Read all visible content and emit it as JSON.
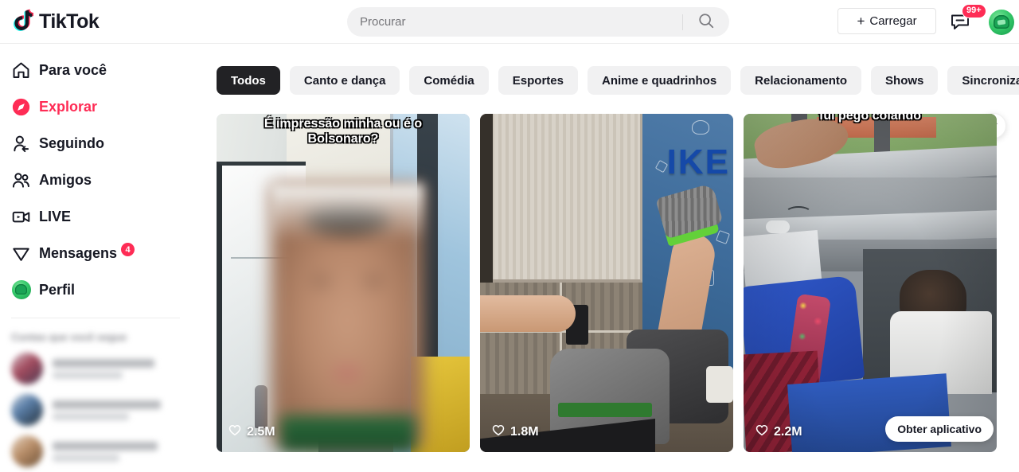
{
  "brand": {
    "name": "TikTok",
    "accent": "#fe2c55",
    "accent_alt": "#25f4ee"
  },
  "search": {
    "placeholder": "Procurar",
    "value": "",
    "icon": "search-icon"
  },
  "header": {
    "upload_label": "Carregar",
    "upload_icon": "plus-icon",
    "inbox_icon": "message-icon",
    "inbox_badge": "99+",
    "avatar_icon": "user-avatar"
  },
  "sidebar": {
    "items": [
      {
        "label": "Para você",
        "icon": "home-icon",
        "active": false,
        "badge": ""
      },
      {
        "label": "Explorar",
        "icon": "compass-icon",
        "active": true,
        "badge": ""
      },
      {
        "label": "Seguindo",
        "icon": "user-follow-icon",
        "active": false,
        "badge": ""
      },
      {
        "label": "Amigos",
        "icon": "users-icon",
        "active": false,
        "badge": ""
      },
      {
        "label": "LIVE",
        "icon": "live-video-icon",
        "active": false,
        "badge": ""
      },
      {
        "label": "Mensagens",
        "icon": "send-icon",
        "active": false,
        "badge": "4"
      },
      {
        "label": "Perfil",
        "icon": "profile-avatar-icon",
        "active": false,
        "badge": ""
      }
    ],
    "following_heading": "Contas que você segue",
    "following": [
      {
        "name": "",
        "subtitle": ""
      },
      {
        "name": "",
        "subtitle": ""
      },
      {
        "name": "",
        "subtitle": ""
      }
    ]
  },
  "main": {
    "chips": [
      {
        "label": "Todos",
        "active": true
      },
      {
        "label": "Canto e dança",
        "active": false
      },
      {
        "label": "Comédia",
        "active": false
      },
      {
        "label": "Esportes",
        "active": false
      },
      {
        "label": "Anime e quadrinhos",
        "active": false
      },
      {
        "label": "Relacionamento",
        "active": false
      },
      {
        "label": "Shows",
        "active": false
      },
      {
        "label": "Sincronização labial",
        "active": false
      }
    ],
    "next_icon": "chevron-right-icon",
    "videos": [
      {
        "caption": "É impressão minha ou é o Bolsonaro?",
        "likes": "2.5M",
        "like_icon": "heart-icon",
        "caption_clipped": false
      },
      {
        "caption": "",
        "likes": "1.8M",
        "like_icon": "heart-icon",
        "caption_clipped": false
      },
      {
        "caption": "fui pego colando",
        "likes": "2.2M",
        "like_icon": "heart-icon",
        "caption_clipped": true
      }
    ],
    "get_app_label": "Obter aplicativo"
  }
}
